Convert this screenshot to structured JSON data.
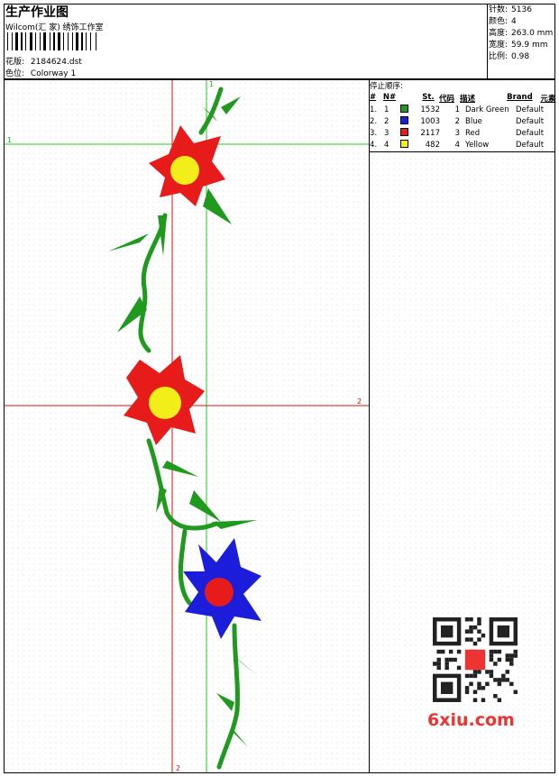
{
  "header": {
    "title": "生产作业图",
    "company": "Wilcom(汇 家) 绣饰工作室",
    "design_label": "花版:",
    "design_value": "2184624.dst",
    "color_label": "色位:",
    "color_value": "Colorway 1"
  },
  "specs": [
    {
      "label": "针数:",
      "value": "5136"
    },
    {
      "label": "颜色:",
      "value": "4"
    },
    {
      "label": "高度:",
      "value": "263.0 mm"
    },
    {
      "label": "宽度:",
      "value": "59.9 mm"
    },
    {
      "label": "比例:",
      "value": "0.98"
    }
  ],
  "stop_sequence": {
    "title": "停止顺序:",
    "headers": {
      "num": "#",
      "n": "N#",
      "st": "St.",
      "code": "代码",
      "desc": "描述",
      "brand": "Brand",
      "element": "元素"
    },
    "rows": [
      {
        "num": "1.",
        "n": "1",
        "color": "#1f9a1f",
        "st": "1532",
        "code": "1",
        "desc": "Dark Green",
        "brand": "Default"
      },
      {
        "num": "2.",
        "n": "2",
        "color": "#1c1cdb",
        "st": "1003",
        "code": "2",
        "desc": "Blue",
        "brand": "Default"
      },
      {
        "num": "3.",
        "n": "3",
        "color": "#e81b1b",
        "st": "2117",
        "code": "3",
        "desc": "Red",
        "brand": "Default"
      },
      {
        "num": "4.",
        "n": "4",
        "color": "#f2ee1a",
        "st": "482",
        "code": "4",
        "desc": "Yellow",
        "brand": "Default"
      }
    ]
  },
  "guides": {
    "v1": "1",
    "h1": "1",
    "h2": "2",
    "v2": "2"
  },
  "watermark": "6xiu.com",
  "colors": {
    "green": "#1f9a1f",
    "blue": "#1c1cdb",
    "red": "#e81b1b",
    "yellow": "#f2ee1a"
  }
}
